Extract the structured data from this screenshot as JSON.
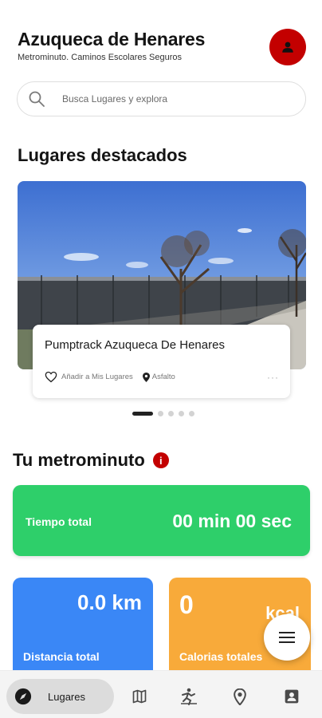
{
  "header": {
    "title": "Azuqueca de Henares",
    "subtitle": "Metrominuto. Caminos Escolares Seguros",
    "avatar_icon": "person-icon"
  },
  "search": {
    "placeholder": "Busca Lugares y explora",
    "icon": "search-icon"
  },
  "featured": {
    "section_title": "Lugares destacados",
    "card": {
      "name": "Pumptrack Azuqueca De Henares",
      "favorite_label": "Añadir a Mis Lugares",
      "location": "Asfalto",
      "more": "···"
    },
    "carousel": {
      "total": 5,
      "active_index": 0
    }
  },
  "metrominuto": {
    "section_title": "Tu metrominuto",
    "info_icon": "i",
    "time": {
      "label": "Tiempo total",
      "value": "00 min 00 sec"
    },
    "distance": {
      "label": "Distancia total",
      "value": "0.0 km"
    },
    "calories": {
      "label": "Calorias totales",
      "value": "0",
      "unit": "kcal"
    }
  },
  "nav": {
    "items": [
      {
        "label": "Lugares",
        "icon": "compass-icon",
        "active": true
      },
      {
        "icon": "map-icon"
      },
      {
        "icon": "activity-icon"
      },
      {
        "icon": "location-pin-icon"
      },
      {
        "icon": "profile-icon"
      }
    ]
  },
  "colors": {
    "accent_red": "#c30000",
    "time_card": "#2ecf6a",
    "distance_card": "#3a87f6",
    "calories_card": "#f8aa3a"
  }
}
